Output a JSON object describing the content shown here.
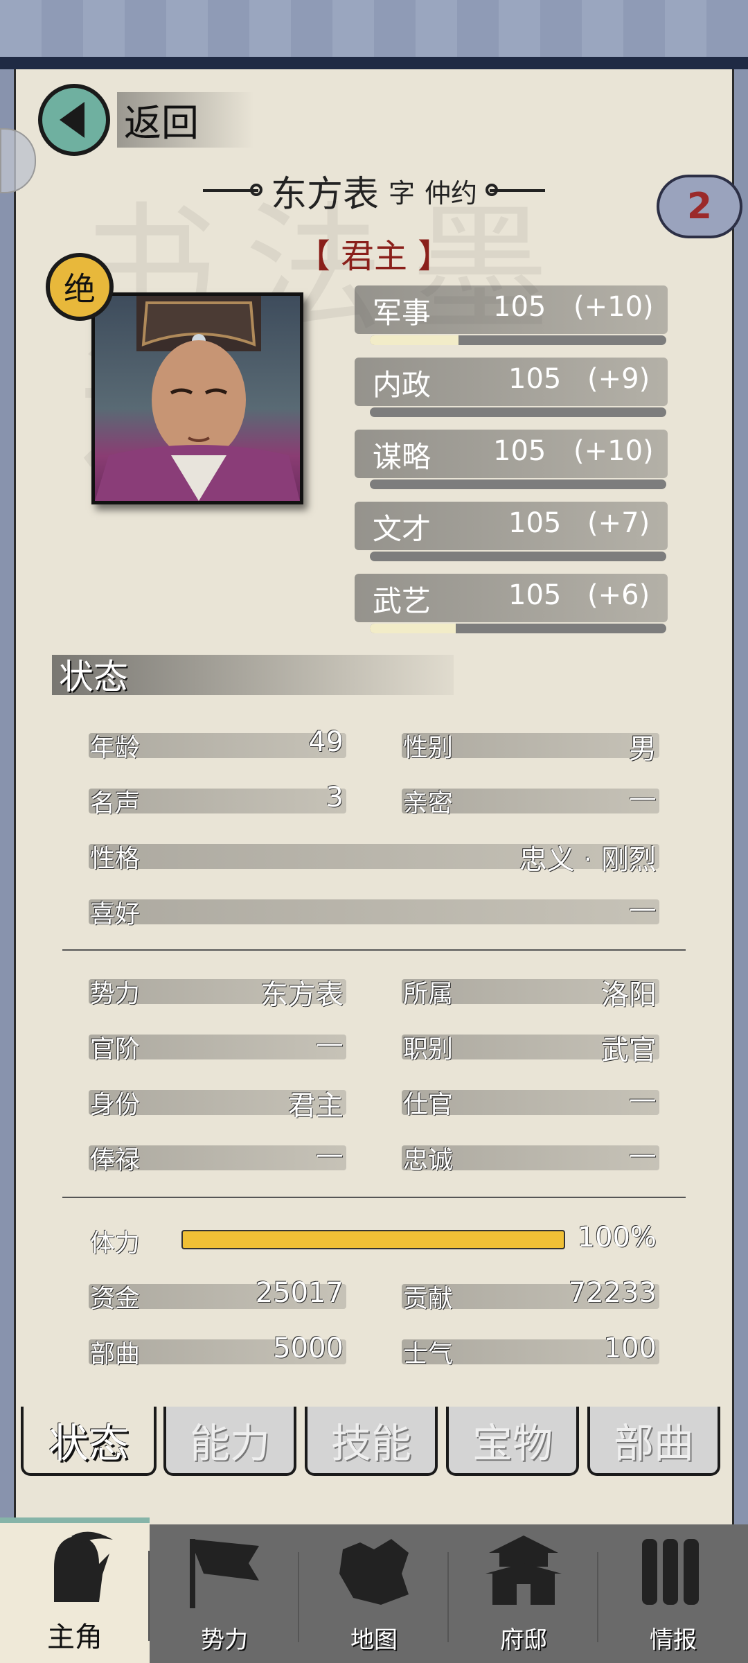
{
  "header": {
    "back_label": "返回",
    "name": "东方表",
    "zi_label": "字",
    "courtesy_name": "仲约",
    "title": "【 君主 】",
    "badge_count": "2",
    "rank_badge": "绝"
  },
  "attributes": [
    {
      "name": "军事",
      "value": "105",
      "bonus": "(+10)",
      "progress": 0.3
    },
    {
      "name": "内政",
      "value": "105",
      "bonus": "(+9)",
      "progress": 0.0
    },
    {
      "name": "谋略",
      "value": "105",
      "bonus": "(+10)",
      "progress": 0.0
    },
    {
      "name": "文才",
      "value": "105",
      "bonus": "(+7)",
      "progress": 0.0
    },
    {
      "name": "武艺",
      "value": "105",
      "bonus": "(+6)",
      "progress": 0.29
    }
  ],
  "status_section": {
    "title": "状态",
    "age": {
      "label": "年龄",
      "value": "49"
    },
    "gender": {
      "label": "性别",
      "value": "男"
    },
    "fame": {
      "label": "名声",
      "value": "3"
    },
    "intimacy": {
      "label": "亲密",
      "value": "—"
    },
    "personality": {
      "label": "性格",
      "value": "忠义 · 刚烈"
    },
    "hobby": {
      "label": "喜好",
      "value": "—"
    },
    "faction": {
      "label": "势力",
      "value": "东方表"
    },
    "belong": {
      "label": "所属",
      "value": "洛阳"
    },
    "rank": {
      "label": "官阶",
      "value": "—"
    },
    "post": {
      "label": "职别",
      "value": "武官"
    },
    "identity": {
      "label": "身份",
      "value": "君主"
    },
    "office": {
      "label": "仕官",
      "value": "—"
    },
    "salary": {
      "label": "俸禄",
      "value": "—"
    },
    "loyalty": {
      "label": "忠诚",
      "value": "—"
    },
    "stamina": {
      "label": "体力",
      "value": "100%",
      "fraction": 1.0
    },
    "funds": {
      "label": "资金",
      "value": "25017"
    },
    "contribution": {
      "label": "贡献",
      "value": "72233"
    },
    "troops": {
      "label": "部曲",
      "value": "5000"
    },
    "morale": {
      "label": "士气",
      "value": "100"
    }
  },
  "tabs": [
    "状态",
    "能力",
    "技能",
    "宝物",
    "部曲"
  ],
  "nav": [
    {
      "label": "主角",
      "icon": "warrior-icon"
    },
    {
      "label": "势力",
      "icon": "flag-icon"
    },
    {
      "label": "地图",
      "icon": "map-icon"
    },
    {
      "label": "府邸",
      "icon": "mansion-icon"
    },
    {
      "label": "情报",
      "icon": "scroll-icon"
    }
  ],
  "colors": {
    "accent": "#e8b83b",
    "title_red": "#8a1f1a",
    "stamina": "#f0c036",
    "teal": "#6fb0a0"
  }
}
